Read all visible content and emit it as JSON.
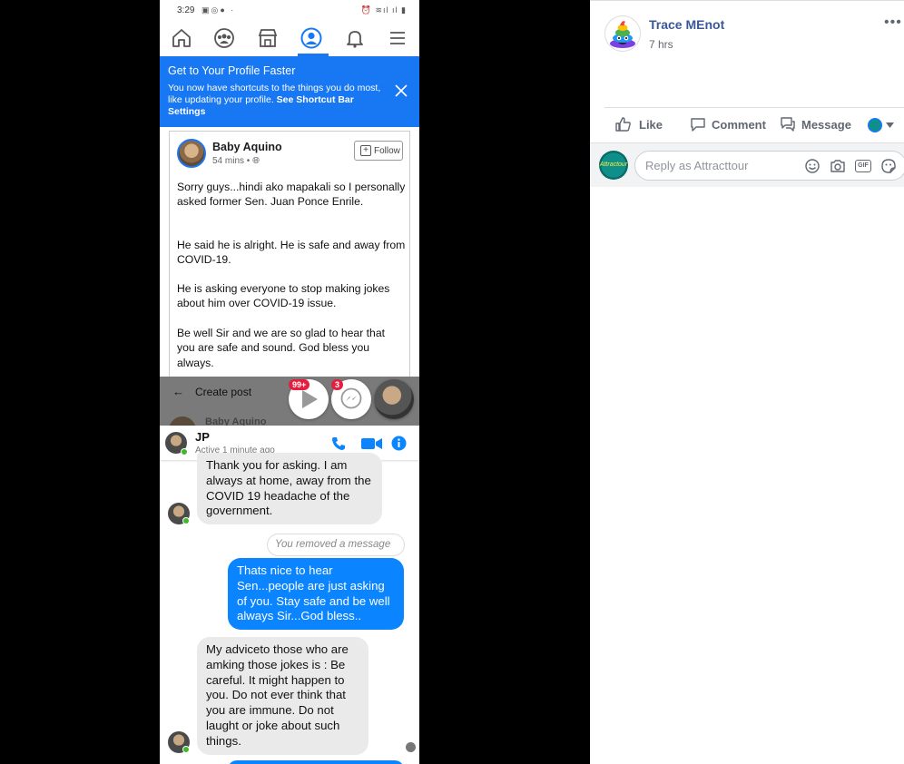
{
  "phone": {
    "status_time": "3:29",
    "banner": {
      "title": "Get to Your Profile Faster",
      "body": "You now have shortcuts to the things you do most, like updating your profile.",
      "link": "See Shortcut Bar Settings"
    },
    "post": {
      "author": "Baby Aquino",
      "meta": "54 mins •",
      "follow_label": "Follow",
      "paragraphs": [
        "Sorry guys...hindi ako mapakali so I personally asked former Sen. Juan Ponce Enrile.",
        "He said he is alright. He is safe and away from COVID-19.",
        "He is asking everyone to stop making jokes about him over COVID-19 issue.",
        "Be well Sir and we are so glad to hear that you are safe and sound. God bless you always."
      ]
    },
    "create_post_label": "Create post",
    "behind_name": "Baby Aquino",
    "bubbles": {
      "video_badge": "99+",
      "messenger_badge": "3"
    },
    "chat": {
      "contact_name": "JP",
      "contact_status": "Active 1 minute ago",
      "messages": [
        {
          "from": "in",
          "text": "Thank you for asking. I am always at home, away from the COVID 19 headache of the government."
        },
        {
          "from": "system",
          "text": "You removed a message"
        },
        {
          "from": "out",
          "text": "Thats nice to hear Sen...people are just asking of you. Stay safe and be well always Sir...God bless.."
        },
        {
          "from": "in",
          "text": "My adviceto those who are amking those jokes is : Be careful. It might happen to you. Do not ever think that you are immune. Do not laught or joke about such things."
        }
      ]
    },
    "colors": {
      "fb_blue": "#1877f2",
      "messenger_blue": "#0a84ff",
      "online_green": "#42b72a"
    }
  },
  "panel": {
    "poster_name": "Trace MEnot",
    "poster_time": "7 hrs",
    "more_label": "•••",
    "actions": {
      "like": "Like",
      "comment": "Comment",
      "message": "Message"
    },
    "reply_placeholder": "Reply as Attracttour",
    "reply_avatar_text": "Attractour",
    "gif_label": "GIF",
    "icons": [
      "like-icon",
      "comment-icon",
      "message-icon",
      "emoji-icon",
      "camera-icon",
      "gif-icon",
      "sticker-icon"
    ]
  }
}
